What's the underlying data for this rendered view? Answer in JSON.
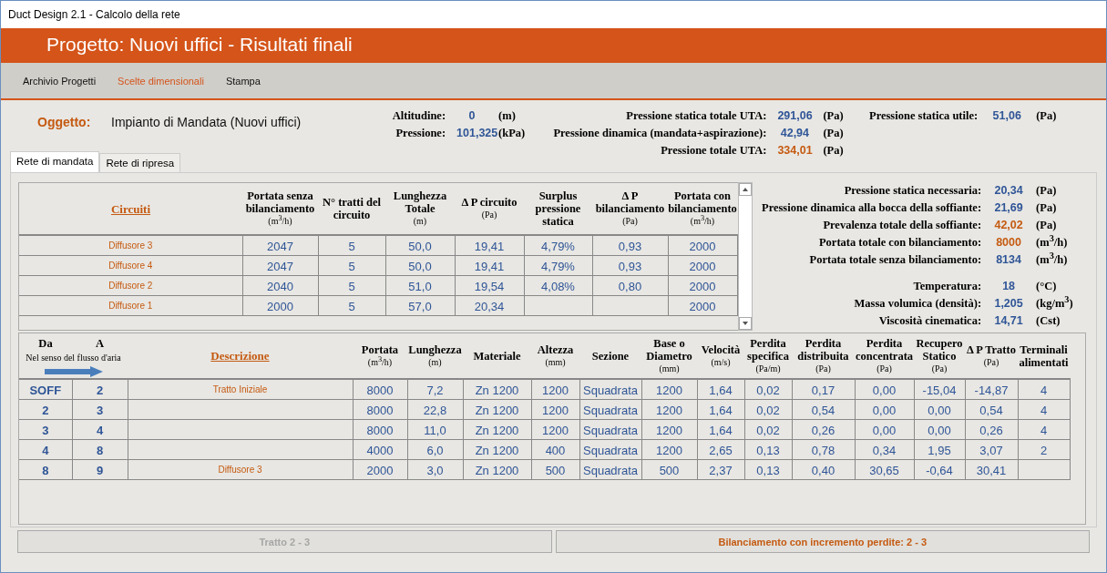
{
  "window": {
    "title": "Duct Design 2.1 - Calcolo della rete"
  },
  "header": {
    "title": "Progetto: Nuovi uffici - Risultati finali"
  },
  "menu": [
    {
      "label": "Archivio Progetti",
      "selected": false
    },
    {
      "label": "Scelte dimensionali",
      "selected": true
    },
    {
      "label": "Stampa",
      "selected": false
    }
  ],
  "object": {
    "label": "Oggetto:",
    "value": "Impianto di Mandata (Nuovi uffici)"
  },
  "site": [
    {
      "label": "Altitudine:",
      "value": "0",
      "unit": "(m)",
      "highlight": false
    },
    {
      "label": "Pressione:",
      "value": "101,325",
      "unit": "(kPa)",
      "highlight": false
    }
  ],
  "uta": [
    {
      "label": "Pressione statica totale UTA:",
      "value": "291,06",
      "unit": "(Pa)",
      "highlight": false
    },
    {
      "label": "Pressione dinamica (mandata+aspirazione):",
      "value": "42,94",
      "unit": "(Pa)",
      "highlight": false
    },
    {
      "label": "Pressione totale UTA:",
      "value": "334,01",
      "unit": "(Pa)",
      "highlight": true
    }
  ],
  "useful": [
    {
      "label": "Pressione statica utile:",
      "value": "51,06",
      "unit": "(Pa)",
      "highlight": false
    }
  ],
  "tabs": [
    {
      "label": "Rete di mandata",
      "selected": true
    },
    {
      "label": "Rete di ripresa",
      "selected": false
    }
  ],
  "circuits": {
    "columns": [
      {
        "title": "Circuiti",
        "kind": "link"
      },
      {
        "title": "Portata senza bilanciamento",
        "unit": "(m$^{3}$/h)",
        "kind": "value"
      },
      {
        "title": "N° tratti del circuito",
        "kind": "value"
      },
      {
        "title": "Lunghezza Totale",
        "unit": "(m)",
        "kind": "value"
      },
      {
        "title": "Δ P circuito",
        "unit": "(Pa)",
        "kind": "value"
      },
      {
        "title": "Surplus pressione statica",
        "kind": "value"
      },
      {
        "title": "Δ P bilanciamento",
        "unit": "(Pa)",
        "kind": "value"
      },
      {
        "title": "Portata con bilanciamento",
        "unit": "(m$^{3}$/h)",
        "kind": "value"
      }
    ],
    "rows": [
      [
        "Diffusore 3",
        "2047",
        "5",
        "50,0",
        "19,41",
        "4,79%",
        "0,93",
        "2000"
      ],
      [
        "Diffusore 4",
        "2047",
        "5",
        "50,0",
        "19,41",
        "4,79%",
        "0,93",
        "2000"
      ],
      [
        "Diffusore 2",
        "2040",
        "5",
        "51,0",
        "19,54",
        "4,08%",
        "0,80",
        "2000"
      ],
      [
        "Diffusore 1",
        "2000",
        "5",
        "57,0",
        "20,34",
        null,
        null,
        "2000"
      ]
    ]
  },
  "fan": [
    {
      "label": "Pressione statica necessaria:",
      "value": "20,34",
      "unit": "(Pa)",
      "highlight": false
    },
    {
      "label": "Pressione dinamica alla bocca della soffiante:",
      "value": "21,69",
      "unit": "(Pa)",
      "highlight": false
    },
    {
      "label": "Prevalenza totale della soffiante:",
      "value": "42,02",
      "unit": "(Pa)",
      "highlight": true
    },
    {
      "label": "Portata totale con bilanciamento:",
      "value": "8000",
      "unit": "(m$^{3}$/h)",
      "highlight": true
    },
    {
      "label": "Portata totale senza bilanciamento:",
      "value": "8134",
      "unit": "(m$^{3}$/h)",
      "highlight": false
    }
  ],
  "air": [
    {
      "label": "Temperatura:",
      "value": "18",
      "unit": "(°C)",
      "highlight": false
    },
    {
      "label": "Massa volumica (densità):",
      "value": "1,205",
      "unit": "(kg/m$^{3}$)",
      "highlight": false
    },
    {
      "label": "Viscosità cinematica:",
      "value": "14,71",
      "unit": "(Cst)",
      "highlight": false
    }
  ],
  "segments": {
    "flow_note": "Nel senso del flusso d'aria",
    "columns": [
      {
        "title": "Da",
        "kind": "node"
      },
      {
        "title": "A",
        "kind": "node"
      },
      {
        "title": "Descrizione",
        "kind": "link"
      },
      {
        "title": "Portata",
        "unit": "(m$^{3}$/h)",
        "kind": "value"
      },
      {
        "title": "Lunghezza",
        "unit": "(m)",
        "kind": "value"
      },
      {
        "title": "Materiale",
        "kind": "value"
      },
      {
        "title": "Altezza",
        "unit": "(mm)",
        "kind": "value"
      },
      {
        "title": "Sezione",
        "kind": "value"
      },
      {
        "title": "Base o Diametro",
        "unit": "(mm)",
        "kind": "value"
      },
      {
        "title": "Velocità",
        "unit": "(m/s)",
        "kind": "value"
      },
      {
        "title": "Perdita specifica",
        "unit": "(Pa/m)",
        "kind": "value"
      },
      {
        "title": "Perdita distribuita",
        "unit": "(Pa)",
        "kind": "value"
      },
      {
        "title": "Perdita concentrata",
        "unit": "(Pa)",
        "kind": "value"
      },
      {
        "title": "Recupero Statico",
        "unit": "(Pa)",
        "kind": "value"
      },
      {
        "title": "Δ P Tratto",
        "unit": "(Pa)",
        "kind": "value"
      },
      {
        "title": "Terminali alimentati",
        "kind": "value"
      }
    ],
    "rows": [
      [
        "SOFF",
        "2",
        "Tratto Iniziale",
        "8000",
        "7,2",
        "Zn 1200",
        "1200",
        "Squadrata",
        "1200",
        "1,64",
        "0,02",
        "0,17",
        "0,00",
        "-15,04",
        "-14,87",
        "4"
      ],
      [
        "2",
        "3",
        null,
        "8000",
        "22,8",
        "Zn 1200",
        "1200",
        "Squadrata",
        "1200",
        "1,64",
        "0,02",
        "0,54",
        "0,00",
        "0,00",
        "0,54",
        "4"
      ],
      [
        "3",
        "4",
        null,
        "8000",
        "11,0",
        "Zn 1200",
        "1200",
        "Squadrata",
        "1200",
        "1,64",
        "0,02",
        "0,26",
        "0,00",
        "0,00",
        "0,26",
        "4"
      ],
      [
        "4",
        "8",
        null,
        "4000",
        "6,0",
        "Zn 1200",
        "400",
        "Squadrata",
        "1200",
        "2,65",
        "0,13",
        "0,78",
        "0,34",
        "1,95",
        "3,07",
        "2"
      ],
      [
        "8",
        "9",
        "Diffusore 3",
        "2000",
        "3,0",
        "Zn 1200",
        "500",
        "Squadrata",
        "500",
        "2,37",
        "0,13",
        "0,40",
        "30,65",
        "-0,64",
        "30,41",
        null
      ]
    ]
  },
  "buttons": [
    {
      "label": "Tratto 2 - 3",
      "disabled": true
    },
    {
      "label": "Bilanciamento con incremento perdite: 2 - 3",
      "disabled": false
    }
  ]
}
